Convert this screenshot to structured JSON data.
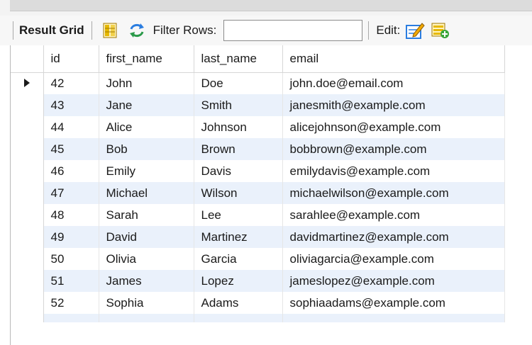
{
  "toolbar": {
    "result_grid_label": "Result Grid",
    "filter_rows_label": "Filter Rows:",
    "filter_value": "",
    "edit_label": "Edit:"
  },
  "icons": {
    "form_editor": "form-editor-icon",
    "refresh": "refresh-icon",
    "edit": "edit-pencil-icon",
    "add_row": "add-row-icon"
  },
  "colors": {
    "alt_row": "#eaf1fb",
    "edit_blue": "#2b7de0",
    "add_green": "#3aa63a",
    "form_yellow": "#e6b800"
  },
  "table": {
    "columns": [
      "id",
      "first_name",
      "last_name",
      "email"
    ],
    "rows": [
      {
        "id": "42",
        "first_name": "John",
        "last_name": "Doe",
        "email": "john.doe@email.com"
      },
      {
        "id": "43",
        "first_name": "Jane",
        "last_name": "Smith",
        "email": "janesmith@example.com"
      },
      {
        "id": "44",
        "first_name": "Alice",
        "last_name": "Johnson",
        "email": "alicejohnson@example.com"
      },
      {
        "id": "45",
        "first_name": "Bob",
        "last_name": "Brown",
        "email": "bobbrown@example.com"
      },
      {
        "id": "46",
        "first_name": "Emily",
        "last_name": "Davis",
        "email": "emilydavis@example.com"
      },
      {
        "id": "47",
        "first_name": "Michael",
        "last_name": "Wilson",
        "email": "michaelwilson@example.com"
      },
      {
        "id": "48",
        "first_name": "Sarah",
        "last_name": "Lee",
        "email": "sarahlee@example.com"
      },
      {
        "id": "49",
        "first_name": "David",
        "last_name": "Martinez",
        "email": "davidmartinez@example.com"
      },
      {
        "id": "50",
        "first_name": "Olivia",
        "last_name": "Garcia",
        "email": "oliviagarcia@example.com"
      },
      {
        "id": "51",
        "first_name": "James",
        "last_name": "Lopez",
        "email": "jameslopez@example.com"
      },
      {
        "id": "52",
        "first_name": "Sophia",
        "last_name": "Adams",
        "email": "sophiaadams@example.com"
      }
    ]
  }
}
